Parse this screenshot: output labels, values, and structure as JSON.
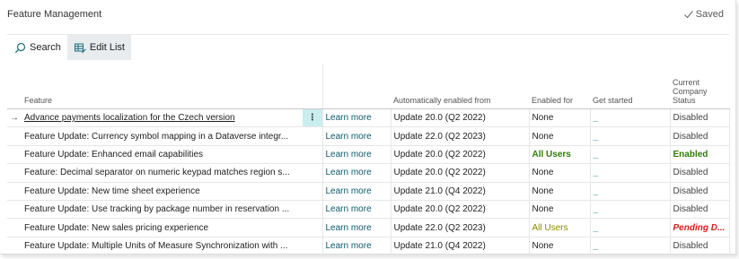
{
  "header": {
    "title": "Feature Management",
    "saved_label": "Saved"
  },
  "toolbar": {
    "search_label": "Search",
    "edit_list_label": "Edit List"
  },
  "columns": {
    "feature": "Feature",
    "auto_enabled": "Automatically enabled from",
    "enabled_for": "Enabled for",
    "get_started": "Get started",
    "status": "Current Company Status"
  },
  "rows": [
    {
      "feature": "Advance payments localization for the Czech version",
      "learn_more": "Learn more",
      "auto_enabled": "Update 20.0 (Q2 2022)",
      "enabled_for": "None",
      "get_started": "_",
      "status": "Disabled"
    },
    {
      "feature": "Feature Update: Currency symbol mapping in a Dataverse integr...",
      "learn_more": "Learn more",
      "auto_enabled": "Update 22.0 (Q2 2023)",
      "enabled_for": "None",
      "get_started": "_",
      "status": "Disabled"
    },
    {
      "feature": "Feature Update: Enhanced email capabilities",
      "learn_more": "Learn more",
      "auto_enabled": "Update 20.0 (Q2 2022)",
      "enabled_for": "All Users",
      "get_started": "_",
      "status": "Enabled"
    },
    {
      "feature": "Feature: Decimal separator on numeric keypad matches region s...",
      "learn_more": "Learn more",
      "auto_enabled": "Update 20.0 (Q2 2022)",
      "enabled_for": "None",
      "get_started": "_",
      "status": "Disabled"
    },
    {
      "feature": "Feature Update: New time sheet experience",
      "learn_more": "Learn more",
      "auto_enabled": "Update 21.0 (Q4 2022)",
      "enabled_for": "None",
      "get_started": "_",
      "status": "Disabled"
    },
    {
      "feature": "Feature Update: Use tracking by package number in reservation ...",
      "learn_more": "Learn more",
      "auto_enabled": "Update 20.0 (Q2 2022)",
      "enabled_for": "None",
      "get_started": "_",
      "status": "Disabled"
    },
    {
      "feature": "Feature Update: New sales pricing experience",
      "learn_more": "Learn more",
      "auto_enabled": "Update 22.0 (Q2 2023)",
      "enabled_for": "All Users",
      "get_started": "_",
      "status": "Pending D..."
    },
    {
      "feature": "Feature Update: Multiple Units of Measure Synchronization with ...",
      "learn_more": "Learn more",
      "auto_enabled": "Update 21.0 (Q4 2022)",
      "enabled_for": "None",
      "get_started": "_",
      "status": "Disabled"
    }
  ],
  "selected_row": {
    "arrow": "→",
    "menu": "⋮"
  },
  "colors": {
    "enabled_green": "#2e7d0a",
    "all_users_olive": "#8a8a00",
    "pending_red": "#d81b1b",
    "link": "#0a5a6a"
  }
}
